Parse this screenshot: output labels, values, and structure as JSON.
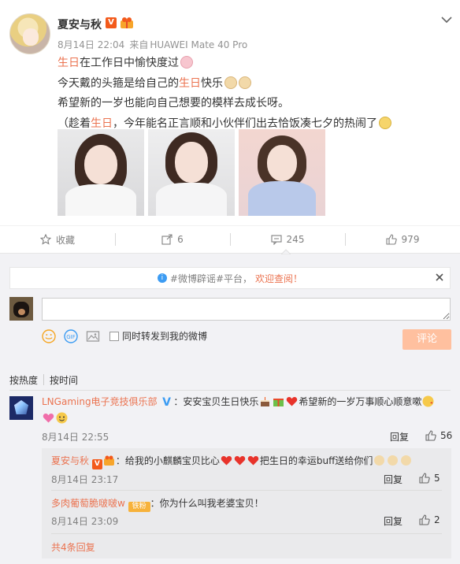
{
  "post": {
    "author": "夏安与秋",
    "vip_label": "V",
    "meta": {
      "time": "8月14日 22:04",
      "source_prefix": "来自",
      "device": "HUAWEI Mate 40 Pro"
    },
    "lines": [
      {
        "hl": "生日",
        "text": "在工作日中愉快度过"
      },
      {
        "pre": "今天戴的头箍是给自己的",
        "hl": "生日",
        "post": "快乐"
      },
      {
        "text": "希望新的一岁也能向自己想要的模样去成长呀。"
      },
      {
        "pre": "（趁着",
        "hl": "生日",
        "post": "，今年能名正言顺和小伙伴们出去恰饭凑七夕的热闹了"
      }
    ]
  },
  "actions": {
    "favorite": "收藏",
    "repost": "6",
    "comment": "245",
    "like": "979"
  },
  "notice": {
    "pre": "#微博辟谣#平台，",
    "link": "欢迎查阅！"
  },
  "composer": {
    "forward_label": "同时转发到我的微博",
    "submit": "评论"
  },
  "sort": {
    "hot": "按热度",
    "time": "按时间"
  },
  "comments": [
    {
      "user": "LNGaming电子竞技俱乐部",
      "text_a": "：安安宝贝生日快乐",
      "text_b": "希望新的一岁万事顺心顺意嗽",
      "date": "8月14日 22:55",
      "reply": "回复",
      "likes": "56",
      "replies": [
        {
          "user": "夏安与秋",
          "text_a": "：给我的小麒麟宝贝比心",
          "text_b": "把生日的幸运buff送给你们",
          "date": "8月14日 23:17",
          "reply": "回复",
          "likes": "5"
        },
        {
          "user": "多肉葡萄脆啵啵w",
          "fan": "铁粉",
          "text": "：你为什么叫我老婆宝贝！",
          "date": "8月14日 23:09",
          "reply": "回复",
          "likes": "2"
        }
      ],
      "more": "共4条回复"
    }
  ]
}
